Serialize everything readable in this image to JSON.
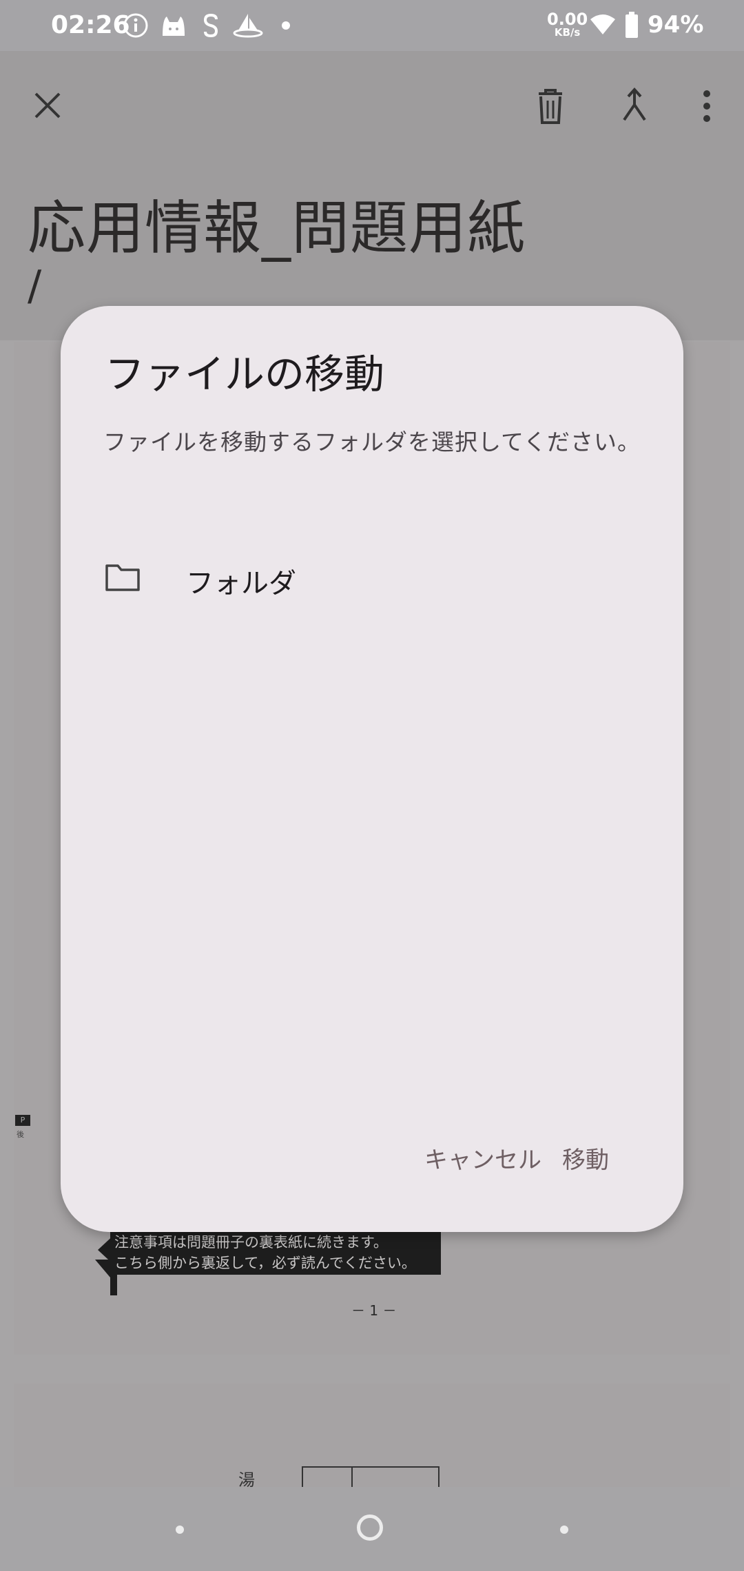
{
  "status_bar": {
    "time": "02:26",
    "net_speed_value": "0.00",
    "net_speed_unit": "KB/s",
    "battery": "94%",
    "icons": [
      "info-icon",
      "cat-icon",
      "s-icon",
      "ship-icon",
      "dot-icon",
      "wifi-icon",
      "battery-icon"
    ]
  },
  "app_bar": {
    "title": "応用情報_問題用紙",
    "path": "/",
    "actions": [
      "close-icon",
      "delete-icon",
      "merge-icon",
      "more-icon"
    ]
  },
  "document": {
    "notice_line1": "注意事項は問題冊子の裏表紙に続きます。",
    "notice_line2": "こちら側から裏返して，必ず読んでください。",
    "page_number": "－ 1 －",
    "side_mark_top": "P",
    "side_mark_bottom": "後",
    "page2_label": "湯"
  },
  "dialog": {
    "title": "ファイルの移動",
    "message": "ファイルを移動するフォルダを選択してください。",
    "folders": [
      {
        "label": "フォルダ",
        "icon": "folder-icon"
      }
    ],
    "cancel_label": "キャンセル",
    "move_label": "移動"
  },
  "nav_bar": {
    "items": [
      "back-dot",
      "home-circle",
      "recents-dot"
    ]
  },
  "colors": {
    "scrim": "#a7a5a6",
    "dialog_bg": "#ece7eb",
    "button_text": "#6e5f63"
  }
}
